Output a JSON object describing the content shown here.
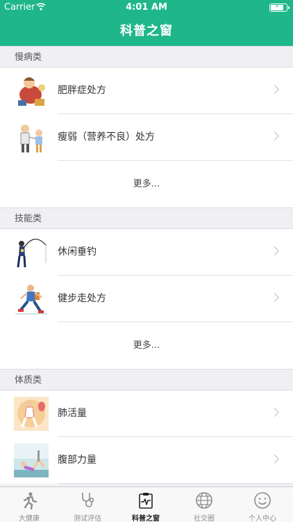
{
  "status_bar": {
    "carrier": "Carrier",
    "time": "4:01 AM"
  },
  "nav": {
    "title": "科普之窗"
  },
  "sections": [
    {
      "header": "慢病类",
      "items": [
        {
          "label": "肥胖症处方"
        },
        {
          "label": "瘦弱（营养不良）处方"
        }
      ],
      "more": "更多..."
    },
    {
      "header": "技能类",
      "items": [
        {
          "label": "休闲垂钓"
        },
        {
          "label": "健步走处方"
        }
      ],
      "more": "更多..."
    },
    {
      "header": "体质类",
      "items": [
        {
          "label": "肺活量"
        },
        {
          "label": "腹部力量"
        }
      ]
    }
  ],
  "tabbar": {
    "tabs": [
      {
        "label": "大健康"
      },
      {
        "label": "测试评估"
      },
      {
        "label": "科普之窗"
      },
      {
        "label": "社交圈"
      },
      {
        "label": "个人中心"
      }
    ],
    "active": "科普之窗"
  },
  "colors": {
    "accent": "#1fb78a"
  }
}
